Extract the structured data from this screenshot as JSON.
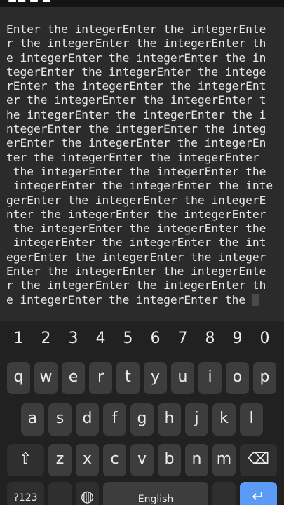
{
  "terminal": {
    "lines": [
      "Enter the integerEnter the integerEnte",
      "r the integerEnter the integerEnter th",
      "e integerEnter the integerEnter the in",
      "tegerEnter the integerEnter the intege",
      "rEnter the integerEnter the integerEnt",
      "er the integerEnter the integerEnter t",
      "he integerEnter the integerEnter the i",
      "ntegerEnter the integerEnter the integ",
      "erEnter the integerEnter the integerEn",
      "ter the integerEnter the integerEnter ",
      " the integerEnter the integerEnter the",
      " integerEnter the integerEnter the inte",
      "gerEnter the integerEnter the integerE",
      "nter the integerEnter the integerEnter",
      " the integerEnter the integerEnter the",
      " integerEnter the integerEnter the int",
      "egerEnter the integerEnter the integer",
      "Enter the integerEnter the integerEnte",
      "r the integerEnter the integerEnter th",
      "e integerEnter the integerEnter the "
    ]
  },
  "keyboard": {
    "numbers": [
      "1",
      "2",
      "3",
      "4",
      "5",
      "6",
      "7",
      "8",
      "9",
      "0"
    ],
    "row1": [
      "q",
      "w",
      "e",
      "r",
      "t",
      "y",
      "u",
      "i",
      "o",
      "p"
    ],
    "row2": [
      "a",
      "s",
      "d",
      "f",
      "g",
      "h",
      "j",
      "k",
      "l"
    ],
    "row3": [
      "z",
      "x",
      "c",
      "v",
      "b",
      "n",
      "m"
    ],
    "symbols_label": "?123",
    "space_label": "English",
    "shift_glyph": "⇧",
    "backspace_glyph": "⌫",
    "globe_glyph": "◍",
    "enter_glyph": "↵"
  },
  "colors": {
    "terminal_bg": "#2b2b2b",
    "keyboard_bg": "#212121",
    "key_bg": "#3d3d3d",
    "accent": "#5b9bf5"
  }
}
